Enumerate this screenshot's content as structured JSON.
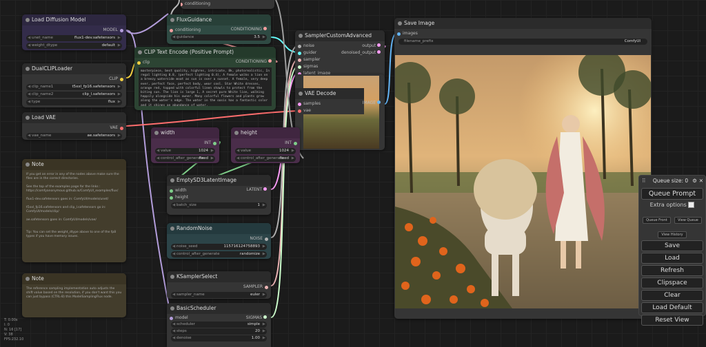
{
  "colors": {
    "model": "#b39ddb",
    "clip": "#f5d142",
    "conditioning": "#f49f9f",
    "vae": "#ff6e6e",
    "latent": "#ff9cf9",
    "int": "#7fcf8a",
    "image": "#64b5f6",
    "sampler": "#ecb4b4",
    "sigmas": "#cdffcd",
    "noise": "#b0b0b0",
    "guider": "#66ffff"
  },
  "top_stub": {
    "label": "conditioning"
  },
  "load_diffusion": {
    "title": "Load Diffusion Model",
    "output": "MODEL",
    "unet_label": "unet_name",
    "unet_value": "flux1-dev.safetensors",
    "dtype_label": "weight_dtype",
    "dtype_value": "default"
  },
  "dual_clip": {
    "title": "DualCLIPLoader",
    "output": "CLIP",
    "c1_label": "clip_name1",
    "c1_value": "t5xxl_fp16.safetensors",
    "c2_label": "clip_name2",
    "c2_value": "clip_l.safetensors",
    "type_label": "type",
    "type_value": "flux"
  },
  "load_vae": {
    "title": "Load VAE",
    "output": "VAE",
    "label": "vae_name",
    "value": "ae.safetensors"
  },
  "note1": {
    "title": "Note",
    "text": "If you get an error in any of the nodes above make sure the files are in the correct directories.\n\nSee the top of the examples page for the links :\nhttps://comfyanonymous.github.io/ComfyUI_examples/flux/\n\nflux1-dev.safetensors goes in: ComfyUI/models/unet/\n\nt5xxl_fp16.safetensors and clip_l.safetensors go in: ComfyUI/models/clip/\n\nae.safetensors goes in: ComfyUI/models/vae/\n\n\nTip: You can set the weight_dtype above to one of the fp8 types if you have memory issues."
  },
  "note2": {
    "title": "Note",
    "text": "The reference sampling implementation auto adjusts the shift value based on the resolution, if you don't want this you can just bypass (CTRL-B) this ModelSamplingFlux node."
  },
  "flux_guidance": {
    "title": "FluxGuidance",
    "in": "conditioning",
    "out": "CONDITIONING",
    "g_label": "guidance",
    "g_value": "3.5"
  },
  "clip_encode": {
    "title": "CLIP Text Encode (Positive Prompt)",
    "in": "clip",
    "out": "CONDITIONING",
    "text": "masterpiece, best quality, highres, intricate, 8k, photorealistic, In regal lighting 0.8, (perfect lighting 0.4), A female walks a lion on a breezy waterside moat as sun is over a sunset. A female, very deep ever, perfect face, perfect body, wear cool. Star White dresses, orange red, topped with colorful linen shawls to protect from the biting sun. The lion is large 1, A secret pure White lion, walking happily alongside his owner. Many colorful flowers and plants grow along the water's edge. The water in the oasis has a fantastic color and it shines an abundance of water."
  },
  "sampler_custom": {
    "title": "SamplerCustomAdvanced",
    "inputs": [
      "noise",
      "guider",
      "sampler",
      "sigmas",
      "latent_image"
    ],
    "out1": "output",
    "out2": "denoised_output"
  },
  "vae_decode": {
    "title": "VAE Decode",
    "in1": "samples",
    "in2": "vae",
    "out": "IMAGE"
  },
  "width": {
    "title": "width",
    "out": "INT",
    "v_label": "value",
    "v_value": "1024",
    "c_label": "control_after_generate",
    "c_value": "fixed"
  },
  "height": {
    "title": "height",
    "out": "INT",
    "v_label": "value",
    "v_value": "1024",
    "c_label": "control_after_generate",
    "c_value": "fixed"
  },
  "empty_latent": {
    "title": "EmptySD3LatentImage",
    "in1": "width",
    "in2": "height",
    "out": "LATENT",
    "b_label": "batch_size",
    "b_value": "1"
  },
  "random_noise": {
    "title": "RandomNoise",
    "out": "NOISE",
    "s_label": "noise_seed",
    "s_value": "115716124758893",
    "c_label": "control_after_generate",
    "c_value": "randomize"
  },
  "ksampler_select": {
    "title": "KSamplerSelect",
    "out": "SAMPLER",
    "s_label": "sampler_name",
    "s_value": "euler"
  },
  "basic_scheduler": {
    "title": "BasicScheduler",
    "in": "model",
    "out": "SIGMAS",
    "sc_label": "scheduler",
    "sc_value": "simple",
    "st_label": "steps",
    "st_value": "20",
    "d_label": "denoise",
    "d_value": "1.00"
  },
  "save_image": {
    "title": "Save Image",
    "in": "images",
    "p_label": "filename_prefix",
    "p_value": "ComfyUI"
  },
  "queue": {
    "title": "Queue size: 0",
    "queue_prompt": "Queue Prompt",
    "extra": "Extra options",
    "queue_front": "Queue Front",
    "view_queue": "View Queue",
    "view_history": "View History",
    "save": "Save",
    "load": "Load",
    "refresh": "Refresh",
    "clipspace": "Clipspace",
    "clear": "Clear",
    "load_default": "Load Default",
    "reset_view": "Reset View"
  },
  "stats": [
    "T: 0.00s",
    "I: 0",
    "N: 16 [17]",
    "V: 38",
    "FPS:232.10"
  ]
}
